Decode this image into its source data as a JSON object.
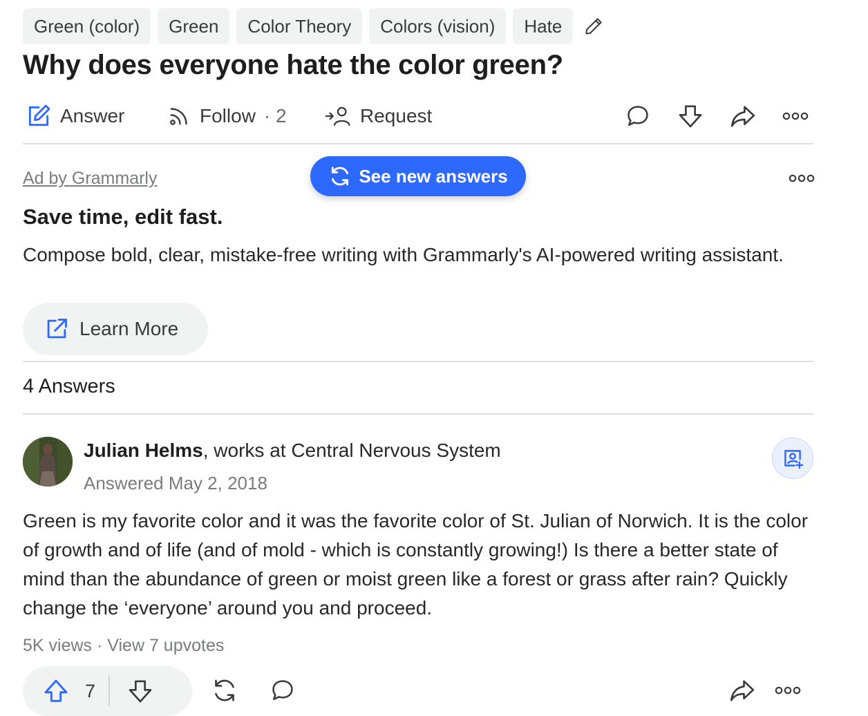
{
  "topics": [
    "Green (color)",
    "Green",
    "Color Theory",
    "Colors (vision)",
    "Hate"
  ],
  "question": {
    "title": "Why does everyone hate the color green?"
  },
  "actions": {
    "answer_label": "Answer",
    "follow_label": "Follow",
    "follow_count": "· 2",
    "request_label": "Request"
  },
  "ad": {
    "label": "Ad by Grammarly",
    "headline": "Save time, edit fast.",
    "body": "Compose bold, clear, mistake-free writing with Grammarly's AI-powered writing assistant.",
    "cta_label": "Learn More"
  },
  "new_answers_label": "See new answers",
  "answers_count": "4 Answers",
  "answer": {
    "author_name": "Julian Helms",
    "author_credential": ", works at Central Nervous System",
    "answered_date": "Answered May 2, 2018",
    "body": "Green is my favorite color and it was the favorite color of St. Julian of Norwich. It is the color of growth and of life (and of mold - which is constantly growing!) Is there a better state of mind than the abundance of green or moist green like a forest or grass after rain? Quickly change the ‘everyone’ around you and proceed.",
    "views": "5K views",
    "upvotes_link": "View 7 upvotes",
    "upvote_count": "7"
  },
  "colors": {
    "accent": "#2e69ff",
    "text": "#282829",
    "muted": "#7a7b7d",
    "chip_bg": "#f1f2f2"
  },
  "icons": [
    "pencil-icon",
    "answer-edit-icon",
    "follow-feed-icon",
    "request-person-icon",
    "comment-icon",
    "downvote-icon",
    "share-icon",
    "more-icon",
    "refresh-icon",
    "external-link-icon",
    "follow-person-icon",
    "upvote-icon",
    "reshare-icon"
  ]
}
